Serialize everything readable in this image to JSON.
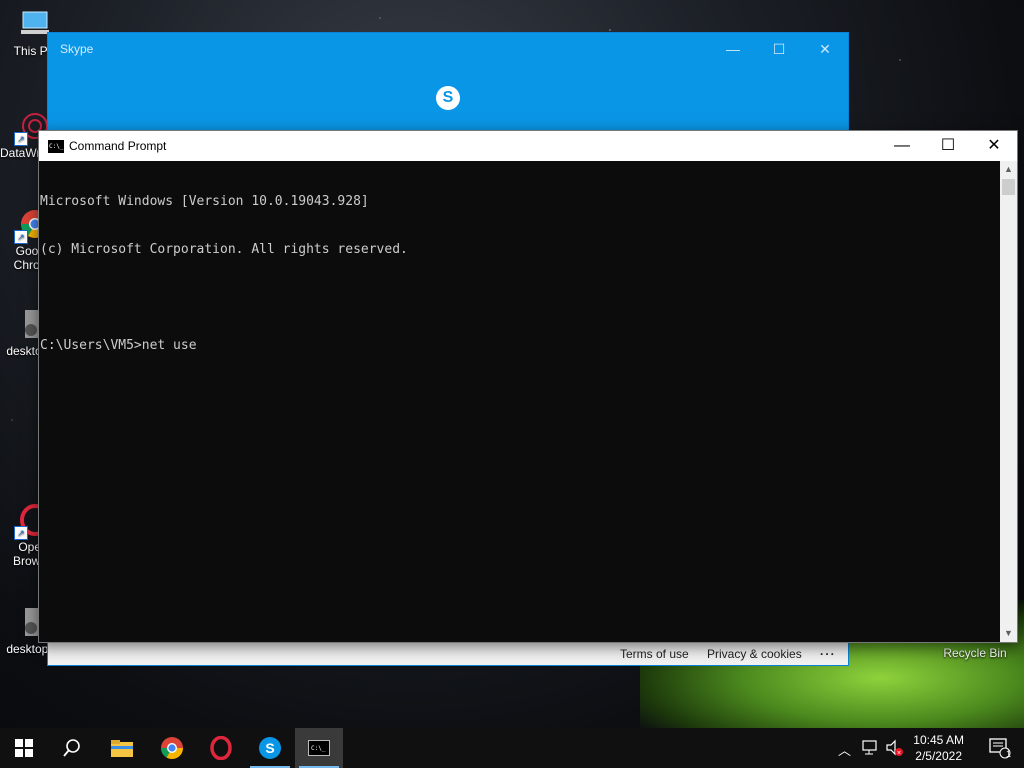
{
  "desktop": {
    "icons": [
      {
        "label": "This PC"
      },
      {
        "label": "DataWrangler"
      },
      {
        "label": "Google Chrome"
      },
      {
        "label": "desktop.ini"
      },
      {
        "label": "Opera Browser"
      },
      {
        "label": "desktop.ini"
      },
      {
        "label": "Recycle Bin"
      }
    ]
  },
  "skype": {
    "title": "Skype",
    "minimize_glyph": "—",
    "maximize_glyph": "☐",
    "close_glyph": "✕",
    "logo_glyph": "S",
    "footer": {
      "terms": "Terms of use",
      "privacy": "Privacy & cookies",
      "more": "..."
    }
  },
  "cmd": {
    "title": "Command Prompt",
    "icon_text": "C:\\_",
    "minimize_glyph": "—",
    "maximize_glyph": "☐",
    "close_glyph": "✕",
    "lines": [
      "Microsoft Windows [Version 10.0.19043.928]",
      "(c) Microsoft Corporation. All rights reserved.",
      "",
      "C:\\Users\\VM5>net use"
    ]
  },
  "taskbar": {
    "apps": [
      {
        "name": "start",
        "icon": "windows-logo"
      },
      {
        "name": "search",
        "icon": "search-icon"
      },
      {
        "name": "file-explorer",
        "icon": "folder-icon"
      },
      {
        "name": "chrome",
        "icon": "chrome-icon"
      },
      {
        "name": "opera",
        "icon": "opera-icon"
      },
      {
        "name": "skype",
        "icon": "skype-icon"
      },
      {
        "name": "command-prompt",
        "icon": "cmd-icon"
      }
    ],
    "time": "10:45 AM",
    "date": "2/5/2022",
    "notification_count": "1"
  },
  "colors": {
    "skype_blue": "#0a96e6",
    "console_bg": "#0c0c0c",
    "console_text": "#cccccc",
    "taskbar": "#101010"
  }
}
